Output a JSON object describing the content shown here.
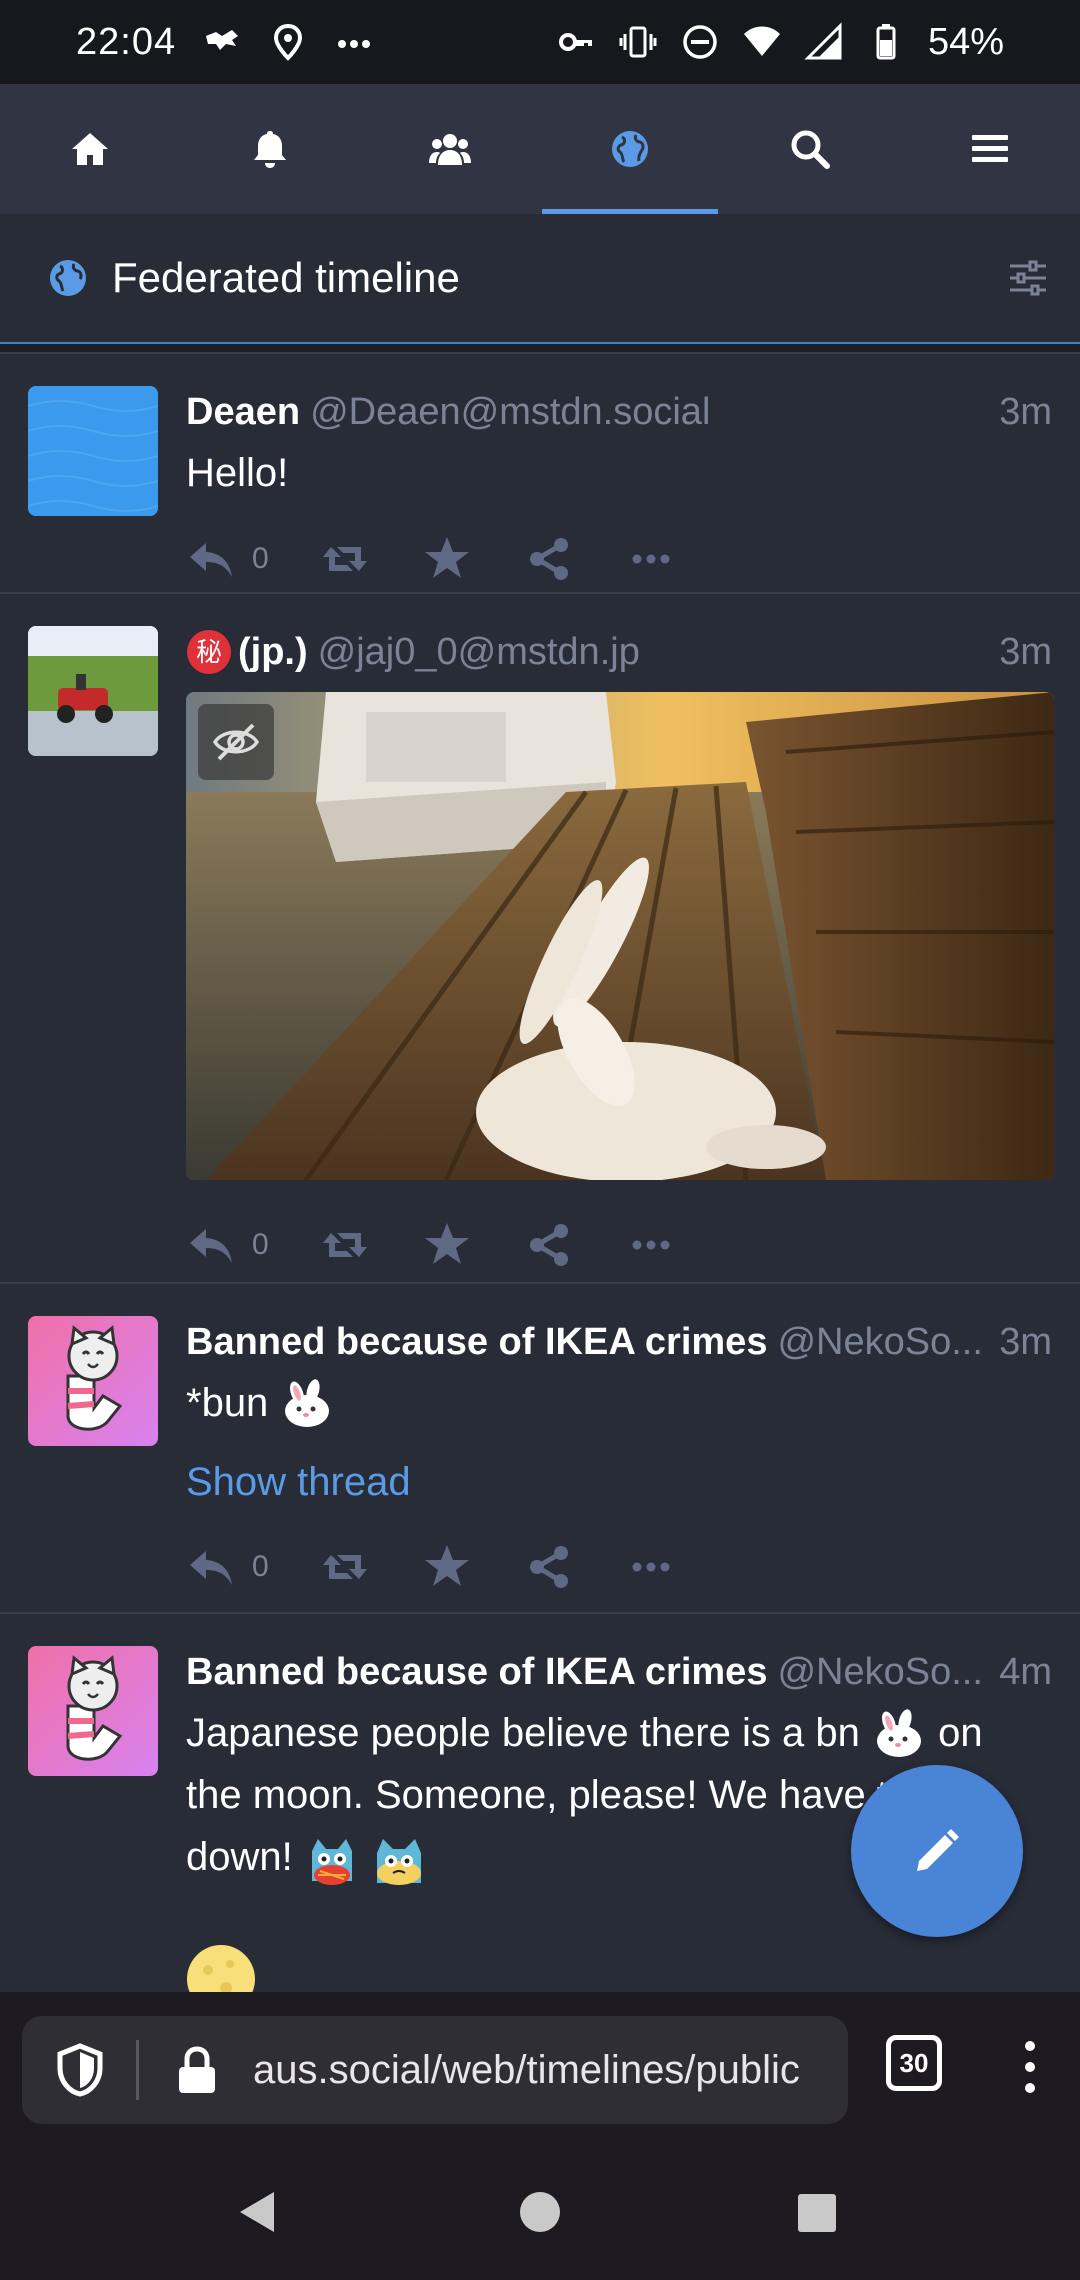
{
  "status_bar": {
    "time": "22:04",
    "battery": "54%"
  },
  "nav": {
    "items": [
      {
        "icon": "home-icon"
      },
      {
        "icon": "bell-icon"
      },
      {
        "icon": "users-icon"
      },
      {
        "icon": "globe-icon",
        "active": true
      },
      {
        "icon": "search-icon"
      },
      {
        "icon": "menu-icon"
      }
    ]
  },
  "column": {
    "title": "Federated timeline"
  },
  "statuses": [
    {
      "name": "Deaen",
      "acct": "@Deaen@mstdn.social",
      "time": "3m",
      "content": "Hello!",
      "replies": "0"
    },
    {
      "name": "(jp.)",
      "name_badge": "秘",
      "acct": "@jaj0_0@mstdn.jp",
      "time": "3m",
      "replies": "0"
    },
    {
      "name": "Banned because of IKEA crimes",
      "acct": "@NekoSo...",
      "time": "3m",
      "content": "*bun",
      "show_thread": "Show thread",
      "replies": "0"
    },
    {
      "name": "Banned because of IKEA crimes",
      "acct": "@NekoSo...",
      "time": "4m",
      "content_1": "Japanese people believe there is a bn",
      "content_2": "on",
      "content_3": "the moon. Someone, please! We have t",
      "content_4": "it",
      "content_5": "down!"
    }
  ],
  "browser": {
    "url": "aus.social/web/timelines/public",
    "tab_count": "30"
  },
  "colors": {
    "accent": "#5b9be5",
    "nav_bg": "#313543",
    "feed_bg": "#282c37",
    "fab": "#4a84d6"
  }
}
